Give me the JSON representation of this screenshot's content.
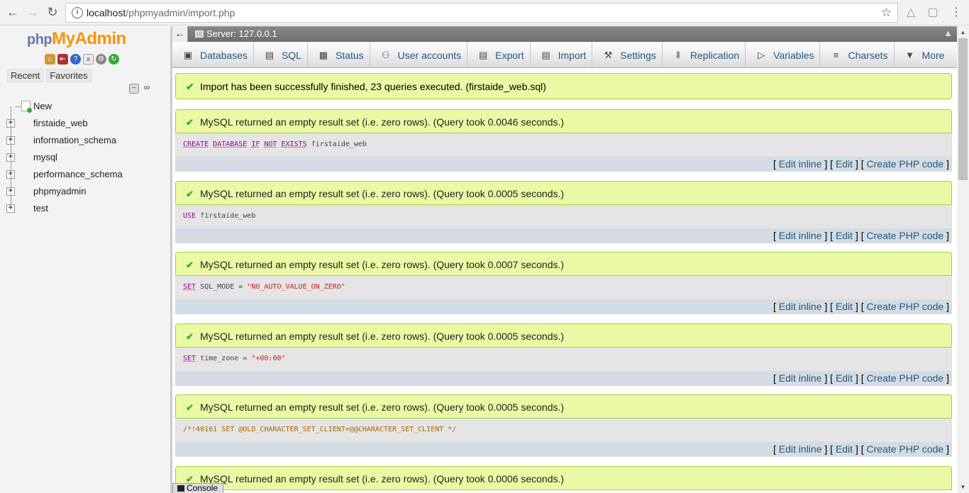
{
  "browser": {
    "url_host": "localhost",
    "url_path": "/phpmyadmin/import.php",
    "info_icon": "info-icon",
    "star_icon": "star-icon"
  },
  "sidebar": {
    "logo_php": "php",
    "logo_myadmin": "MyAdmin",
    "tabs": [
      "Recent",
      "Favorites"
    ],
    "tree": [
      {
        "label": "New",
        "type": "new"
      },
      {
        "label": "firstaide_web",
        "type": "db"
      },
      {
        "label": "information_schema",
        "type": "db"
      },
      {
        "label": "mysql",
        "type": "db"
      },
      {
        "label": "performance_schema",
        "type": "db"
      },
      {
        "label": "phpmyadmin",
        "type": "db"
      },
      {
        "label": "test",
        "type": "db"
      }
    ]
  },
  "serverbar": {
    "label": "Server: 127.0.0.1"
  },
  "menu": {
    "tabs": [
      {
        "label": "Databases",
        "icon": "database-icon"
      },
      {
        "label": "SQL",
        "icon": "sql-icon"
      },
      {
        "label": "Status",
        "icon": "status-icon"
      },
      {
        "label": "User accounts",
        "icon": "user-accounts-icon"
      },
      {
        "label": "Export",
        "icon": "export-icon"
      },
      {
        "label": "Import",
        "icon": "import-icon"
      },
      {
        "label": "Settings",
        "icon": "wrench-icon"
      },
      {
        "label": "Replication",
        "icon": "replication-icon"
      },
      {
        "label": "Variables",
        "icon": "variables-icon"
      },
      {
        "label": "Charsets",
        "icon": "charsets-icon"
      },
      {
        "label": "More",
        "icon": "chevron-down-icon"
      }
    ]
  },
  "content": {
    "import_success": "Import has been successfully finished, 23 queries executed. (firstaide_web.sql)",
    "tools": {
      "edit_inline": "Edit inline",
      "edit": "Edit",
      "create_php": "Create PHP code"
    },
    "results": [
      {
        "message": "MySQL returned an empty result set (i.e. zero rows). (Query took 0.0046 seconds.)",
        "sql": "CREATE DATABASE IF NOT EXISTS firstaide_web"
      },
      {
        "message": "MySQL returned an empty result set (i.e. zero rows). (Query took 0.0005 seconds.)",
        "sql": "USE firstaide_web"
      },
      {
        "message": "MySQL returned an empty result set (i.e. zero rows). (Query took 0.0007 seconds.)",
        "sql": "SET SQL_MODE = \"NO_AUTO_VALUE_ON_ZERO\""
      },
      {
        "message": "MySQL returned an empty result set (i.e. zero rows). (Query took 0.0005 seconds.)",
        "sql": "SET time_zone = \"+00:00\""
      },
      {
        "message": "MySQL returned an empty result set (i.e. zero rows). (Query took 0.0005 seconds.)",
        "sql": "/*!40101 SET @OLD_CHARACTER_SET_CLIENT=@@CHARACTER_SET_CLIENT */"
      },
      {
        "message": "MySQL returned an empty result set (i.e. zero rows). (Query took 0.0006 seconds.)",
        "sql": ""
      }
    ]
  },
  "console": {
    "label": "Console"
  },
  "colors": {
    "success_bg": "#ebf8a4",
    "success_border": "#a2d246",
    "link": "#235a81",
    "sql_keyword": "#990099"
  }
}
